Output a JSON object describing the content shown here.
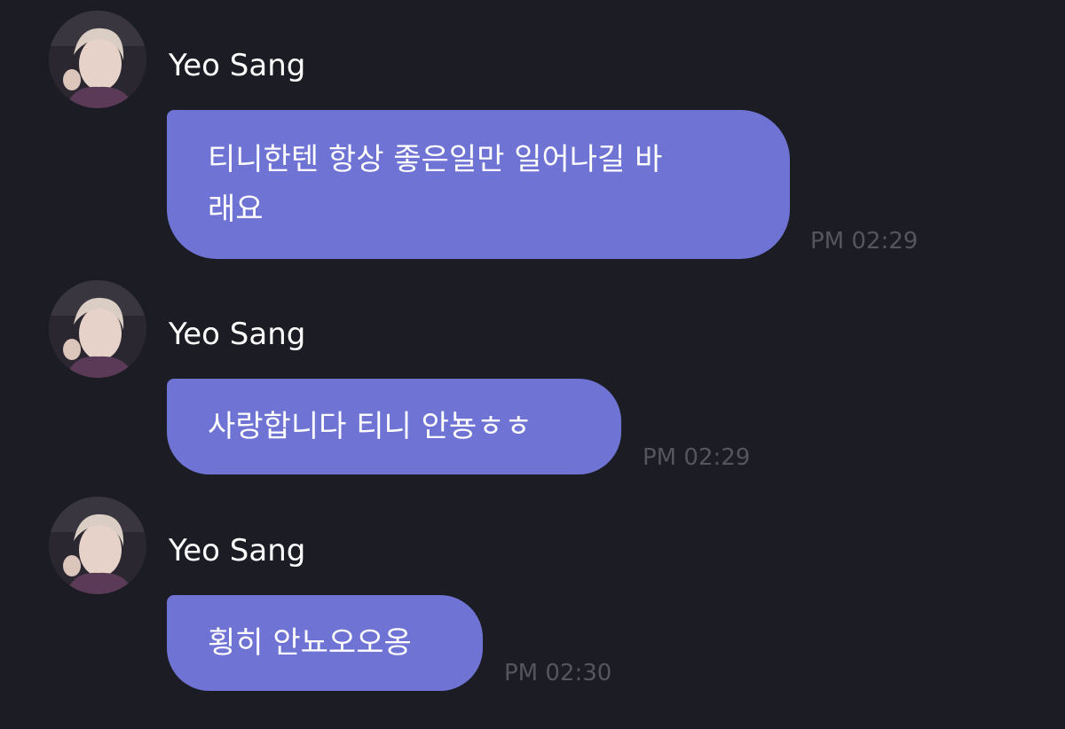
{
  "messages": [
    {
      "sender": "Yeo Sang",
      "lines": [
        "티니한텐 항상 좋은일만 일어나길 바",
        "래요"
      ],
      "time": "PM 02:29"
    },
    {
      "sender": "Yeo Sang",
      "lines": [
        "사랑합니다 티니 안뇽ㅎㅎ"
      ],
      "time": "PM 02:29"
    },
    {
      "sender": "Yeo Sang",
      "lines": [
        "횡히 안뇨오오옹"
      ],
      "time": "PM 02:30"
    }
  ],
  "colors": {
    "background": "#1c1c24",
    "bubble": "#6e73d4",
    "timestamp": "#55555f"
  },
  "icons": {
    "avatar": "profile-photo"
  }
}
